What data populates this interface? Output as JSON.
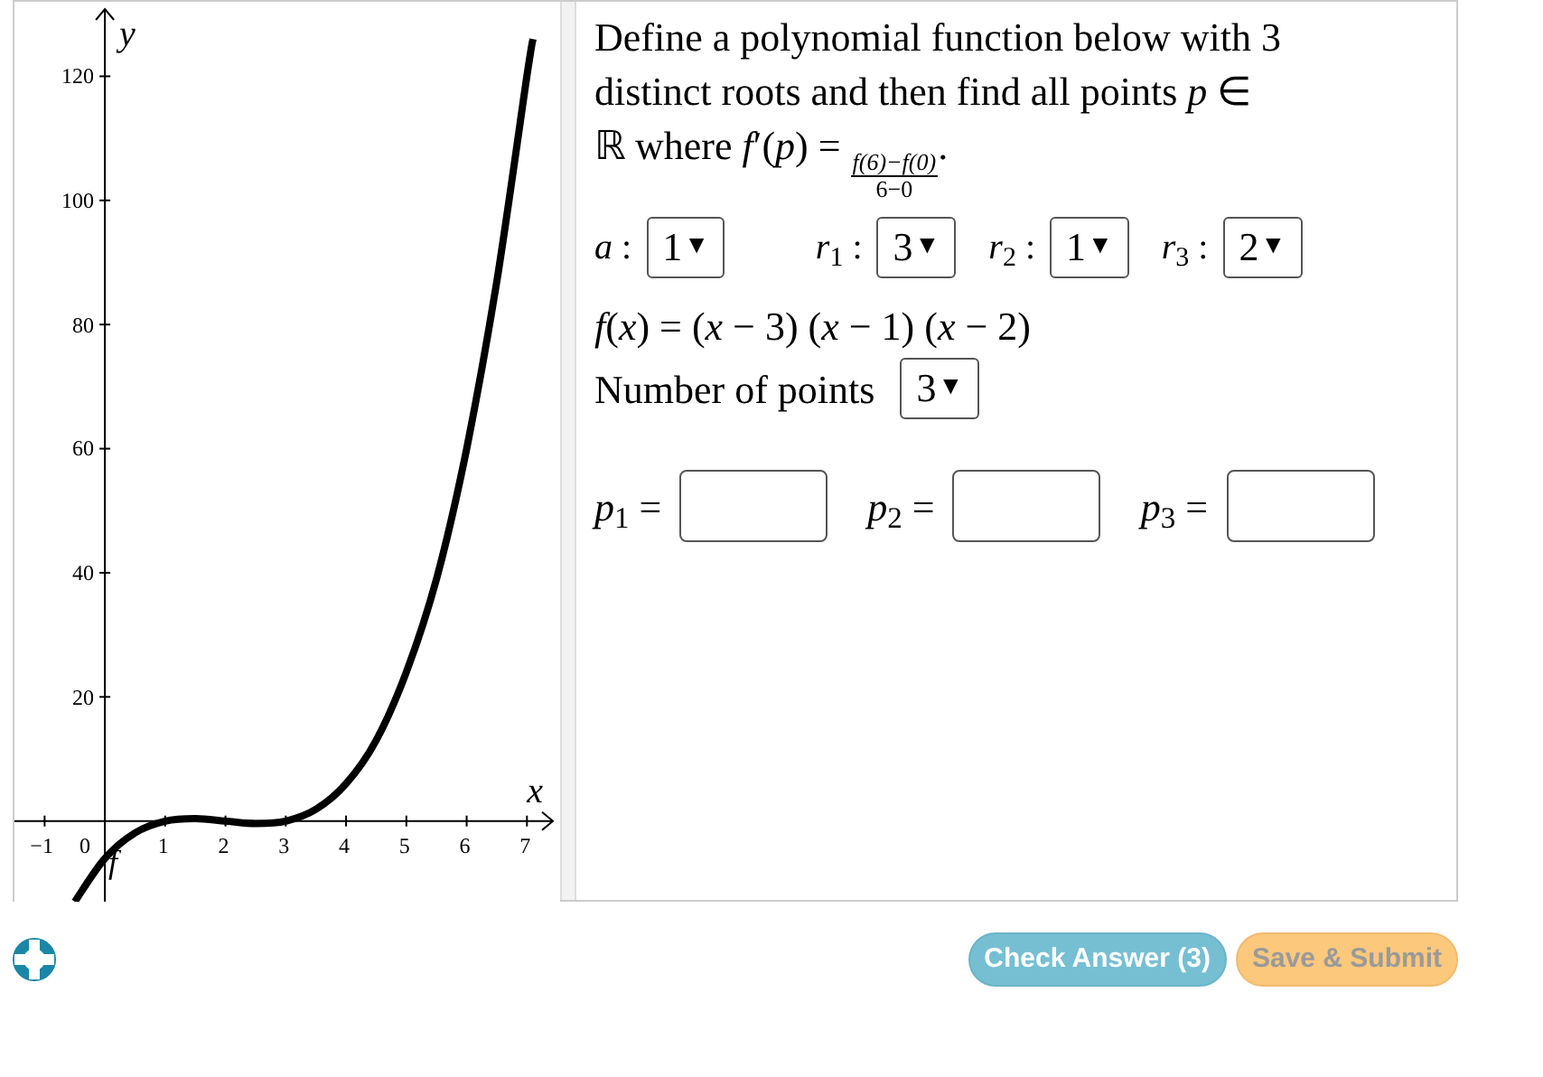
{
  "graph": {
    "x_label": "x",
    "y_label": "y",
    "origin_label": "0",
    "chart_data": {
      "type": "line",
      "x": [
        -0.5,
        0,
        0.5,
        1,
        1.5,
        2,
        2.5,
        3,
        3.5,
        4,
        4.5,
        5,
        5.5,
        6,
        6.5,
        7,
        7.1
      ],
      "series": [
        {
          "name": "f",
          "color": "#000000",
          "values": [
            -13,
            -6,
            -1.9,
            0,
            0.4,
            0,
            -0.4,
            0,
            1.9,
            6,
            13,
            24,
            39,
            60,
            87,
            120,
            126
          ]
        }
      ],
      "xlim": [
        -1.5,
        7.55
      ],
      "ylim": [
        -13,
        132
      ],
      "xticks": [
        -1,
        1,
        2,
        3,
        4,
        5,
        6,
        7
      ],
      "yticks": [
        20,
        40,
        60,
        80,
        100,
        120
      ]
    }
  },
  "question": {
    "text": "Define a polynomial function below with 3 distinct roots and then find all points *p* ∈ ℝ where *f*′(*p*) =",
    "numerator": "f(6)−f(0)",
    "denominator": "6−0",
    "end": "."
  },
  "parameters": [
    {
      "label": "*a* :",
      "value": "1",
      "arrow": "▼"
    },
    {
      "label": "*r*$_{1}$ :",
      "value": "3",
      "arrow": "▼"
    },
    {
      "label": "*r*$_{2}$ :",
      "value": "1",
      "arrow": "▼"
    },
    {
      "label": "*r*$_{3}$ :",
      "value": "2",
      "arrow": "▼"
    }
  ],
  "function_text": "*f*(*x*) = (*x* − 3) (*x* − 1) (*x* − 2)",
  "number_of_points": {
    "label": "Number of points",
    "value": "3",
    "arrow": "▼"
  },
  "answers": [
    {
      "label": "*p*$_{1}$ ="
    },
    {
      "label": "*p*$_{2}$ ="
    },
    {
      "label": "*p*$_{3}$ ="
    }
  ],
  "buttons": [
    {
      "label": "Check Answer (3)",
      "kind": "check"
    },
    {
      "label": "Save & Submit",
      "kind": "submit"
    }
  ]
}
